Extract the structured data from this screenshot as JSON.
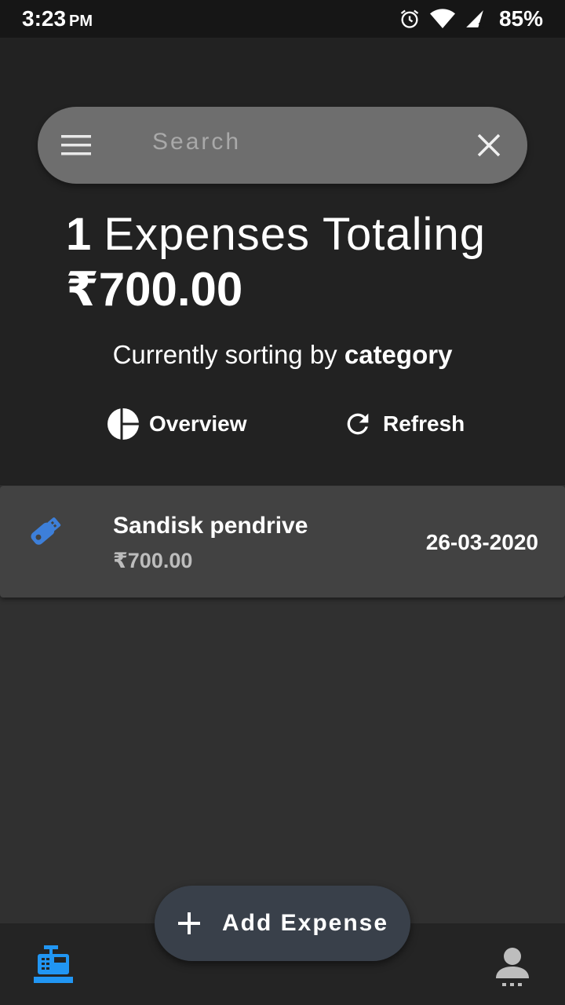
{
  "status_bar": {
    "time": "3:23",
    "ampm": "PM",
    "battery": "85%",
    "icons": [
      "alarm-icon",
      "wifi-icon",
      "signal-icon"
    ]
  },
  "search": {
    "placeholder": "Search"
  },
  "summary": {
    "count": "1",
    "label": "Expenses Totaling",
    "total": "₹700.00"
  },
  "sort": {
    "prefix": "Currently sorting by",
    "value": "category"
  },
  "actions": {
    "overview_label": "Overview",
    "refresh_label": "Refresh"
  },
  "expenses": [
    {
      "name": "Sandisk pendrive",
      "amount": "₹700.00",
      "date": "26-03-2020",
      "icon": "usb-drive-icon"
    }
  ],
  "fab": {
    "label": "Add Expense"
  },
  "bottom_nav": {
    "items": [
      "cash-register-icon",
      "user-icon"
    ]
  },
  "colors": {
    "accent": "#2196f3",
    "icon_blue": "#3d7fd9",
    "header_bg": "#222222",
    "body_bg": "#303030",
    "card_bg": "#424242"
  }
}
